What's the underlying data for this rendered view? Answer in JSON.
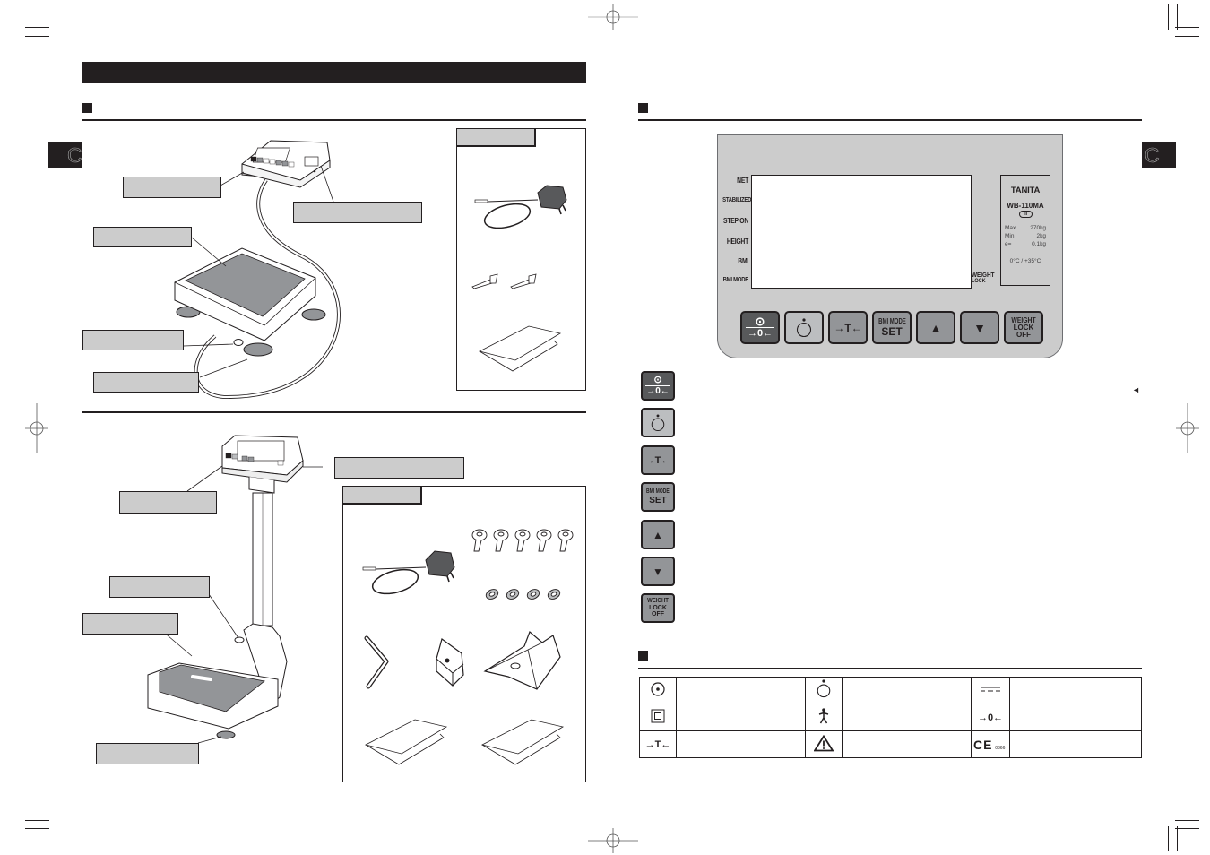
{
  "document": {
    "left_page": {
      "title_bar_text": "",
      "section_1": {
        "heading": "",
        "callouts": {
          "display_unit": "",
          "ac_adapter_jack": "",
          "weighing_platform": "",
          "level_indicator": "",
          "adjustable_feet": ""
        },
        "accessories": {
          "title": "",
          "items": [
            "ac-adapter",
            "wall-screws",
            "instruction-manual"
          ]
        }
      },
      "section_2": {
        "callouts": {
          "display_unit": "",
          "ac_adapter_jack": "",
          "level_indicator": "",
          "weighing_platform": "",
          "adjustable_feet": ""
        },
        "accessories": {
          "title": "",
          "items": [
            "ac-adapter",
            "thumb-screws",
            "washers",
            "hex-wrench",
            "bracket",
            "column-base-cover",
            "instruction-manual",
            "warranty-card"
          ]
        }
      },
      "tab_marker_glyph": "C"
    },
    "right_page": {
      "section_panel": {
        "heading": "",
        "indicators": [
          "NET",
          "STABILIZED",
          "STEP ON",
          "HEIGHT",
          "BMI",
          "BMI MODE"
        ],
        "weight_lock_label": [
          "WEIGHT",
          "LOCK"
        ],
        "spec_plate": {
          "brand": "TANITA",
          "model": "WB-110MA",
          "accuracy_class": "III",
          "max_label": "Max",
          "max_value": "270kg",
          "min_label": "Min",
          "min_value": "2kg",
          "e_label": "e=",
          "e_value": "0,1kg",
          "temp_range": "0°C / +35°C"
        },
        "keys": [
          {
            "id": "power-zero",
            "top": "⊙",
            "bottom": "→0←"
          },
          {
            "id": "height-on",
            "label": "○"
          },
          {
            "id": "tare",
            "label": "→T←"
          },
          {
            "id": "bmi-mode-set",
            "top": "BMI MODE",
            "bottom": "SET"
          },
          {
            "id": "up",
            "label": "▲"
          },
          {
            "id": "down",
            "label": "▼"
          },
          {
            "id": "weight-lock-off",
            "lines": [
              "WEIGHT",
              "LOCK",
              "OFF"
            ]
          }
        ],
        "key_descriptions": [
          "",
          "",
          "",
          "",
          "",
          "",
          ""
        ],
        "side_pointer": "◄"
      },
      "section_symbols": {
        "heading": "",
        "rows": [
          [
            {
              "icon": "⊙",
              "desc": ""
            },
            {
              "icon": "person-ring",
              "desc": ""
            },
            {
              "icon": "dc-symbol",
              "desc": ""
            }
          ],
          [
            {
              "icon": "double-square",
              "desc": ""
            },
            {
              "icon": "body-figure",
              "desc": ""
            },
            {
              "icon": "→0←",
              "desc": ""
            }
          ],
          [
            {
              "icon": "→T←",
              "desc": ""
            },
            {
              "icon": "⚠",
              "desc": ""
            },
            {
              "icon": "CE",
              "ce_number": "0366",
              "desc": ""
            }
          ]
        ]
      },
      "tab_marker_glyph": "C"
    }
  }
}
